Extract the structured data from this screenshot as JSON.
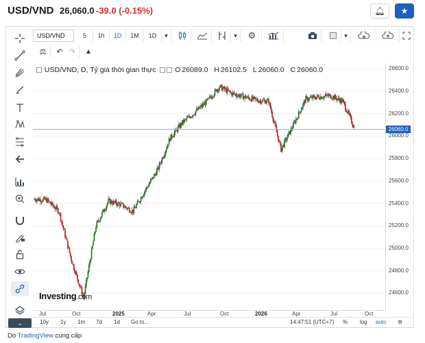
{
  "header": {
    "pair": "USD/VND",
    "price": "26,060.0",
    "change": "-39.0 (-0.15%)",
    "alert_icon": "bell-plus-icon",
    "watch_icon": "star-icon"
  },
  "toolbar": {
    "symbol": "USD/VND",
    "intervals": [
      "5",
      "1h",
      "1D",
      "1M",
      "1D"
    ],
    "active_interval": "1D",
    "icons": [
      "candle-style-icon",
      "area-style-icon",
      "indicators-icon",
      "settings-icon",
      "compare-icon",
      "camera-icon",
      "color-square-icon",
      "cloud-download-icon",
      "cloud-upload-icon",
      "fullscreen-icon"
    ],
    "row2_icons": [
      "balance-icon",
      "undo-icon",
      "redo-icon",
      "alert-add-icon"
    ]
  },
  "left_tools": [
    "crosshair-icon",
    "trend-line-icon",
    "pitchfork-icon",
    "brush-icon",
    "text-icon",
    "pattern-icon",
    "fib-icon",
    "arrow-back-icon",
    "measure-icon",
    "zoom-in-icon",
    "magnet-icon",
    "lock-pencil-icon",
    "lock-icon",
    "eye-icon",
    "link-icon",
    "layers-icon"
  ],
  "legend": {
    "title": "USD/VND, D, Tỷ giá thời gian thực",
    "open_label": "O",
    "open": "26089.0",
    "high_label": "H",
    "high": "26102.5",
    "low_label": "L",
    "low": "26060.0",
    "close_label": "C",
    "close": "26060.0"
  },
  "yaxis": {
    "ticks": [
      "26600.0",
      "26400.0",
      "26200.0",
      "26000.0",
      "25800.0",
      "25600.0",
      "25400.0",
      "25200.0",
      "25000.0",
      "24800.0",
      "24600.0"
    ],
    "last_price": "26060.0",
    "last_color": "#1f5fbf"
  },
  "xaxis": {
    "ticks": [
      "Jul",
      "Oct",
      "2025",
      "Apr",
      "Jul",
      "Oct",
      "2026",
      "Apr",
      "Jul",
      "Oct"
    ],
    "bold_ticks": [
      "2025",
      "2026"
    ]
  },
  "bottom": {
    "ranges": [
      "10y",
      "1y",
      "1m",
      "7d",
      "1d",
      "Go to..."
    ],
    "time": "14:47:51 (UTC+7)",
    "percent": "%",
    "log": "log",
    "auto": "auto"
  },
  "logo": {
    "name": "Investing",
    "suffix": ".com"
  },
  "footer": {
    "prefix": "Do",
    "link": "TradingView",
    "suffix": "cung cấp"
  },
  "colors": {
    "up": "#2e7d32",
    "down": "#c62828",
    "accent": "#1f5fbf"
  },
  "chart_data": {
    "type": "line",
    "x": [
      "2024-06",
      "2024-07",
      "2024-08",
      "2024-09",
      "2024-10",
      "2024-11",
      "2024-12",
      "2025-01",
      "2025-02",
      "2025-03",
      "2025-04",
      "2025-05",
      "2025-06",
      "2025-07",
      "2025-08",
      "2025-09",
      "2025-10",
      "2025-11",
      "2025-12",
      "2026-01",
      "2026-02",
      "2026-03",
      "2026-04",
      "2026-05",
      "2026-06",
      "2026-07",
      "2026-08"
    ],
    "series": [
      {
        "values": [
          25440,
          25430,
          25330,
          24900,
          24560,
          25200,
          25420,
          25390,
          25330,
          25520,
          25700,
          25980,
          26120,
          26210,
          26310,
          26440,
          26380,
          26350,
          26320,
          26310,
          25880,
          26100,
          26330,
          26350,
          26360,
          26310,
          26060
        ]
      }
    ],
    "ylim": [
      24450,
      26650
    ],
    "last_price": 26060
  }
}
